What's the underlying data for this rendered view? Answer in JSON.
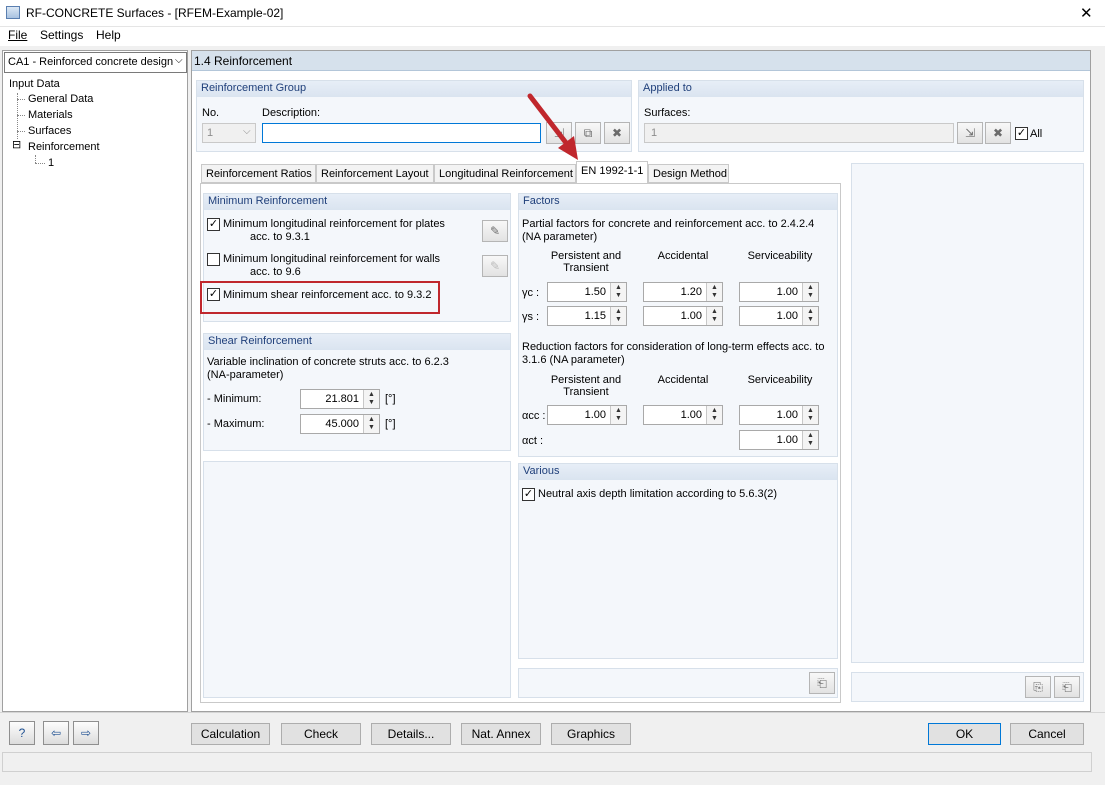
{
  "window": {
    "title": "RF-CONCRETE Surfaces - [RFEM-Example-02]",
    "close_glyph": "✕",
    "app_icon": "app-icon"
  },
  "menu": {
    "file": "File",
    "settings": "Settings",
    "help": "Help"
  },
  "navigator": {
    "case_combo": "CA1 - Reinforced concrete design",
    "root": "Input Data",
    "items": [
      "General Data",
      "Materials",
      "Surfaces",
      "Reinforcement"
    ],
    "sub_item": "1",
    "expander": "⊟"
  },
  "section_title": "1.4 Reinforcement",
  "reinforcement_group": {
    "header": "Reinforcement Group",
    "no_label": "No.",
    "no_value": "1",
    "description_label": "Description:",
    "description_value": ""
  },
  "applied_to": {
    "header": "Applied to",
    "surfaces_label": "Surfaces:",
    "surfaces_value": "1",
    "all_label": "All",
    "all_checked": true
  },
  "tabs": [
    "Reinforcement Ratios",
    "Reinforcement Layout",
    "Longitudinal Reinforcement",
    "EN 1992-1-1",
    "Design Method"
  ],
  "active_tab": "EN 1992-1-1",
  "minimum_reinforcement": {
    "header": "Minimum Reinforcement",
    "items": [
      {
        "line1": "Minimum longitudinal reinforcement for plates",
        "line2": "acc. to 9.3.1",
        "checked": true
      },
      {
        "line1": "Minimum longitudinal reinforcement for walls",
        "line2": "acc. to 9.6",
        "checked": false
      },
      {
        "line1": "Minimum shear reinforcement acc. to 9.3.2",
        "line2": "",
        "checked": true
      }
    ]
  },
  "shear_reinforcement": {
    "header": "Shear Reinforcement",
    "desc_line1": "Variable inclination of concrete struts acc. to 6.2.3",
    "desc_line2": "(NA-parameter)",
    "minimum_label": "- Minimum:",
    "minimum_value": "21.801",
    "maximum_label": "- Maximum:",
    "maximum_value": "45.000",
    "unit": "[°]"
  },
  "factors": {
    "header": "Factors",
    "partial_line1": "Partial factors for concrete and reinforcement acc. to 2.4.2.4",
    "partial_line2": "(NA parameter)",
    "col1_line1": "Persistent and",
    "col1_line2": "Transient",
    "col2": "Accidental",
    "col3": "Serviceability",
    "gamma_c_label": "γc :",
    "gamma_c": [
      "1.50",
      "1.20",
      "1.00"
    ],
    "gamma_s_label": "γs :",
    "gamma_s": [
      "1.15",
      "1.00",
      "1.00"
    ],
    "reduction_line1": "Reduction factors for consideration of long-term effects acc. to",
    "reduction_line2": "3.1.6 (NA parameter)",
    "alpha_cc_label": "αcc :",
    "alpha_cc": [
      "1.00",
      "1.00",
      "1.00"
    ],
    "alpha_ct_label": "αct :",
    "alpha_ct": "1.00"
  },
  "various": {
    "header": "Various",
    "neutral_axis_label": "Neutral axis depth limitation according to 5.6.3(2)",
    "neutral_axis_checked": true
  },
  "buttons": {
    "calculation": "Calculation",
    "check": "Check",
    "details": "Details...",
    "nat_annex": "Nat. Annex",
    "graphics": "Graphics",
    "ok": "OK",
    "cancel": "Cancel"
  },
  "colors": {
    "annotation_red": "#c0272d",
    "group_header_text": "#1f3f7a",
    "section_header_bg": "#d6e1ec"
  }
}
